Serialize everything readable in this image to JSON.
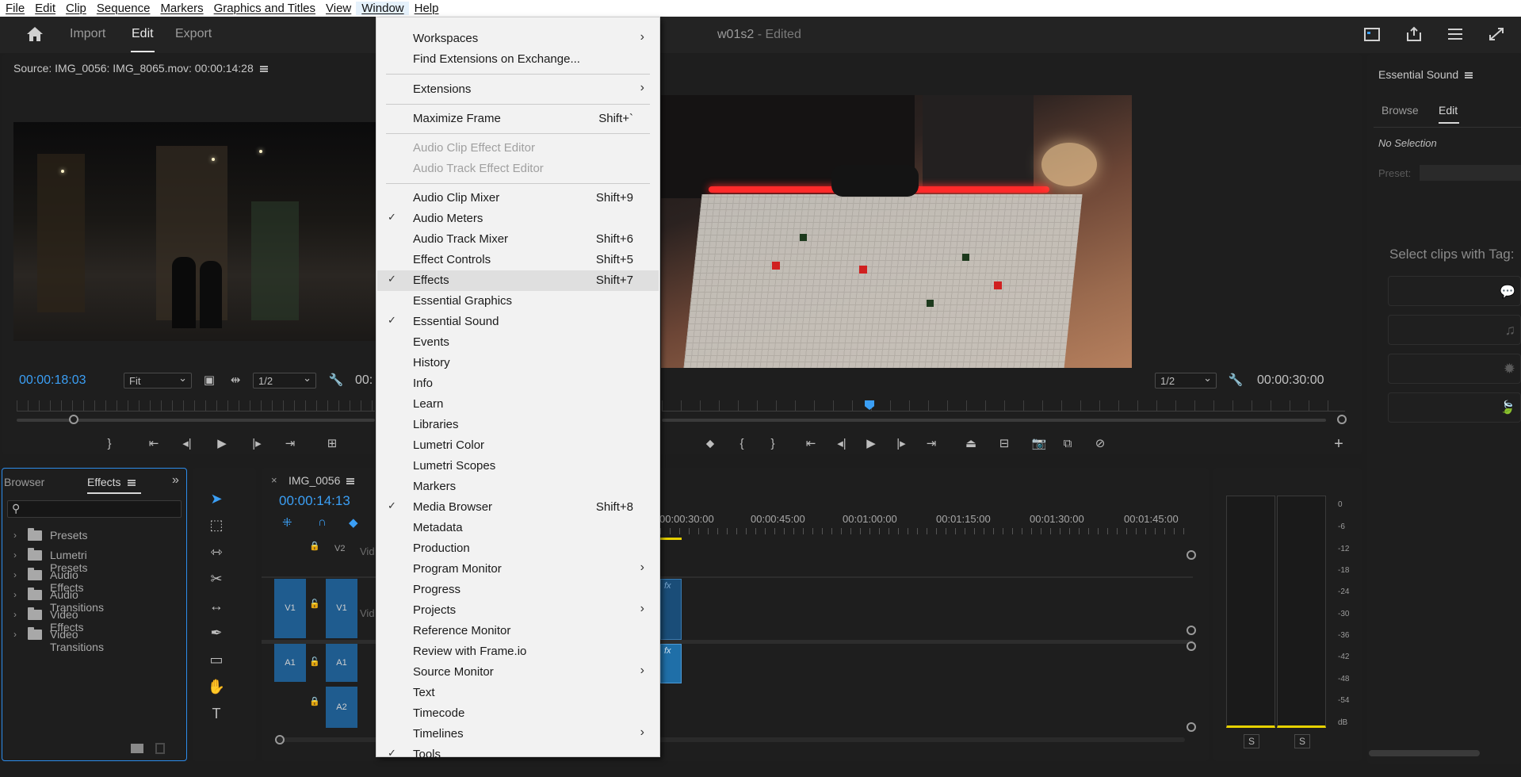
{
  "menubar": {
    "items": [
      "File",
      "Edit",
      "Clip",
      "Sequence",
      "Markers",
      "Graphics and Titles",
      "View",
      "Window",
      "Help"
    ]
  },
  "header": {
    "tabs": [
      "Import",
      "Edit",
      "Export"
    ],
    "title": "w01s2",
    "title_suffix": "- Edited"
  },
  "source_monitor": {
    "title": "Source: IMG_0056: IMG_8065.mov: 00:00:14:28",
    "timecode": "00:00:18:03",
    "zoom": "Fit",
    "resolution": "1/2",
    "duration_partial": "00:"
  },
  "program_monitor": {
    "resolution": "1/2",
    "duration": "00:00:30:00"
  },
  "essential_sound": {
    "title": "Essential Sound",
    "tabs": [
      "Browse",
      "Edit"
    ],
    "no_selection": "No Selection",
    "preset_label": "Preset:",
    "select_clips": "Select clips with Tag:"
  },
  "browser_panel": {
    "tab_browser": "Browser",
    "tab_effects": "Effects",
    "items": [
      "Presets",
      "Lumetri Presets",
      "Audio Effects",
      "Audio Transitions",
      "Video Effects",
      "Video Transitions"
    ]
  },
  "timeline": {
    "sequence_name": "IMG_0056",
    "timecode": "00:00:14:13",
    "ruler": [
      "00:00:30:00",
      "00:00:45:00",
      "00:01:00:00",
      "00:01:15:00",
      "00:01:30:00",
      "00:01:45:00"
    ],
    "tracks": {
      "v2": "V2",
      "v1": "V1",
      "a1": "A1",
      "a2": "A2",
      "video_label": "Vid"
    }
  },
  "audio_meter": {
    "scale": [
      "0",
      "-6",
      "-12",
      "-18",
      "-24",
      "-30",
      "-36",
      "-42",
      "-48",
      "-54",
      "dB"
    ],
    "solo": [
      "S",
      "S"
    ]
  },
  "window_menu": {
    "items": [
      {
        "label": "Workspaces",
        "submenu": true
      },
      {
        "label": "Find Extensions on Exchange..."
      },
      {
        "label": "Extensions",
        "submenu": true
      },
      {
        "label": "Maximize Frame",
        "shortcut": "Shift+`"
      },
      {
        "label": "Audio Clip Effect Editor",
        "disabled": true
      },
      {
        "label": "Audio Track Effect Editor",
        "disabled": true
      },
      {
        "label": "Audio Clip Mixer",
        "shortcut": "Shift+9"
      },
      {
        "label": "Audio Meters",
        "checked": true
      },
      {
        "label": "Audio Track Mixer",
        "shortcut": "Shift+6"
      },
      {
        "label": "Effect Controls",
        "shortcut": "Shift+5"
      },
      {
        "label": "Effects",
        "shortcut": "Shift+7",
        "checked": true
      },
      {
        "label": "Essential Graphics"
      },
      {
        "label": "Essential Sound",
        "checked": true
      },
      {
        "label": "Events"
      },
      {
        "label": "History"
      },
      {
        "label": "Info"
      },
      {
        "label": "Learn"
      },
      {
        "label": "Libraries"
      },
      {
        "label": "Lumetri Color"
      },
      {
        "label": "Lumetri Scopes"
      },
      {
        "label": "Markers"
      },
      {
        "label": "Media Browser",
        "shortcut": "Shift+8",
        "checked": true
      },
      {
        "label": "Metadata"
      },
      {
        "label": "Production"
      },
      {
        "label": "Program Monitor",
        "submenu": true
      },
      {
        "label": "Progress"
      },
      {
        "label": "Projects",
        "submenu": true
      },
      {
        "label": "Reference Monitor"
      },
      {
        "label": "Review with Frame.io"
      },
      {
        "label": "Source Monitor",
        "submenu": true
      },
      {
        "label": "Text"
      },
      {
        "label": "Timecode"
      },
      {
        "label": "Timelines",
        "submenu": true
      },
      {
        "label": "Tools",
        "checked": true
      }
    ]
  },
  "colors": {
    "accent_blue": "#3b9ff5",
    "track_blue": "#1f5c8f",
    "menu_bg": "#f2f2f2",
    "panel_bg": "#1e1e1e"
  }
}
